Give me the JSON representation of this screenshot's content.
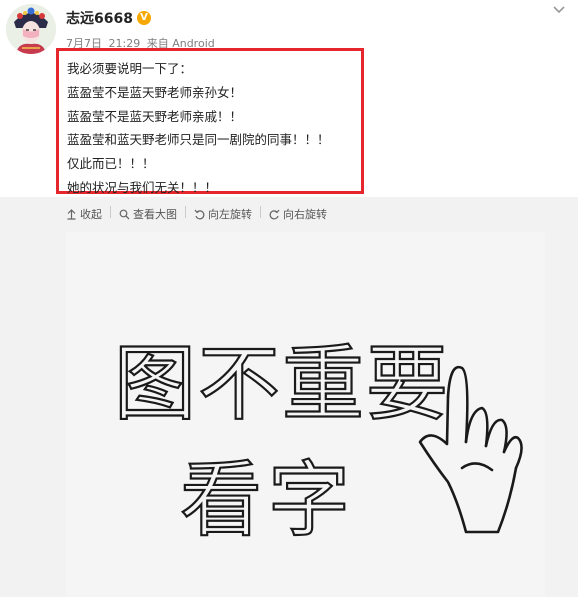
{
  "post": {
    "username": "志远6668",
    "verified_badge": "V",
    "date": "7月7日",
    "time": "21:29",
    "source": "来自 Android",
    "lines": [
      "我必须要说明一下了：",
      "蓝盈莹不是蓝天野老师亲孙女！",
      "蓝盈莹不是蓝天野老师亲戚！！",
      "蓝盈莹和蓝天野老师只是同一剧院的同事！！！",
      "仅此而已！！！",
      "她的状况与我们无关！！！"
    ],
    "highlight_color": "#e5262c"
  },
  "toolbar": {
    "collapse_label": "收起",
    "view_large_label": "查看大图",
    "rotate_left_label": "向左旋转",
    "rotate_right_label": "向右旋转"
  },
  "image": {
    "line1": "图不重要",
    "line2": "看字"
  },
  "icons": [
    "avatar",
    "verified-badge-icon",
    "chevron-down-icon",
    "collapse-icon",
    "search-icon",
    "rotate-left-icon",
    "rotate-right-icon",
    "pointing-hand-icon"
  ]
}
